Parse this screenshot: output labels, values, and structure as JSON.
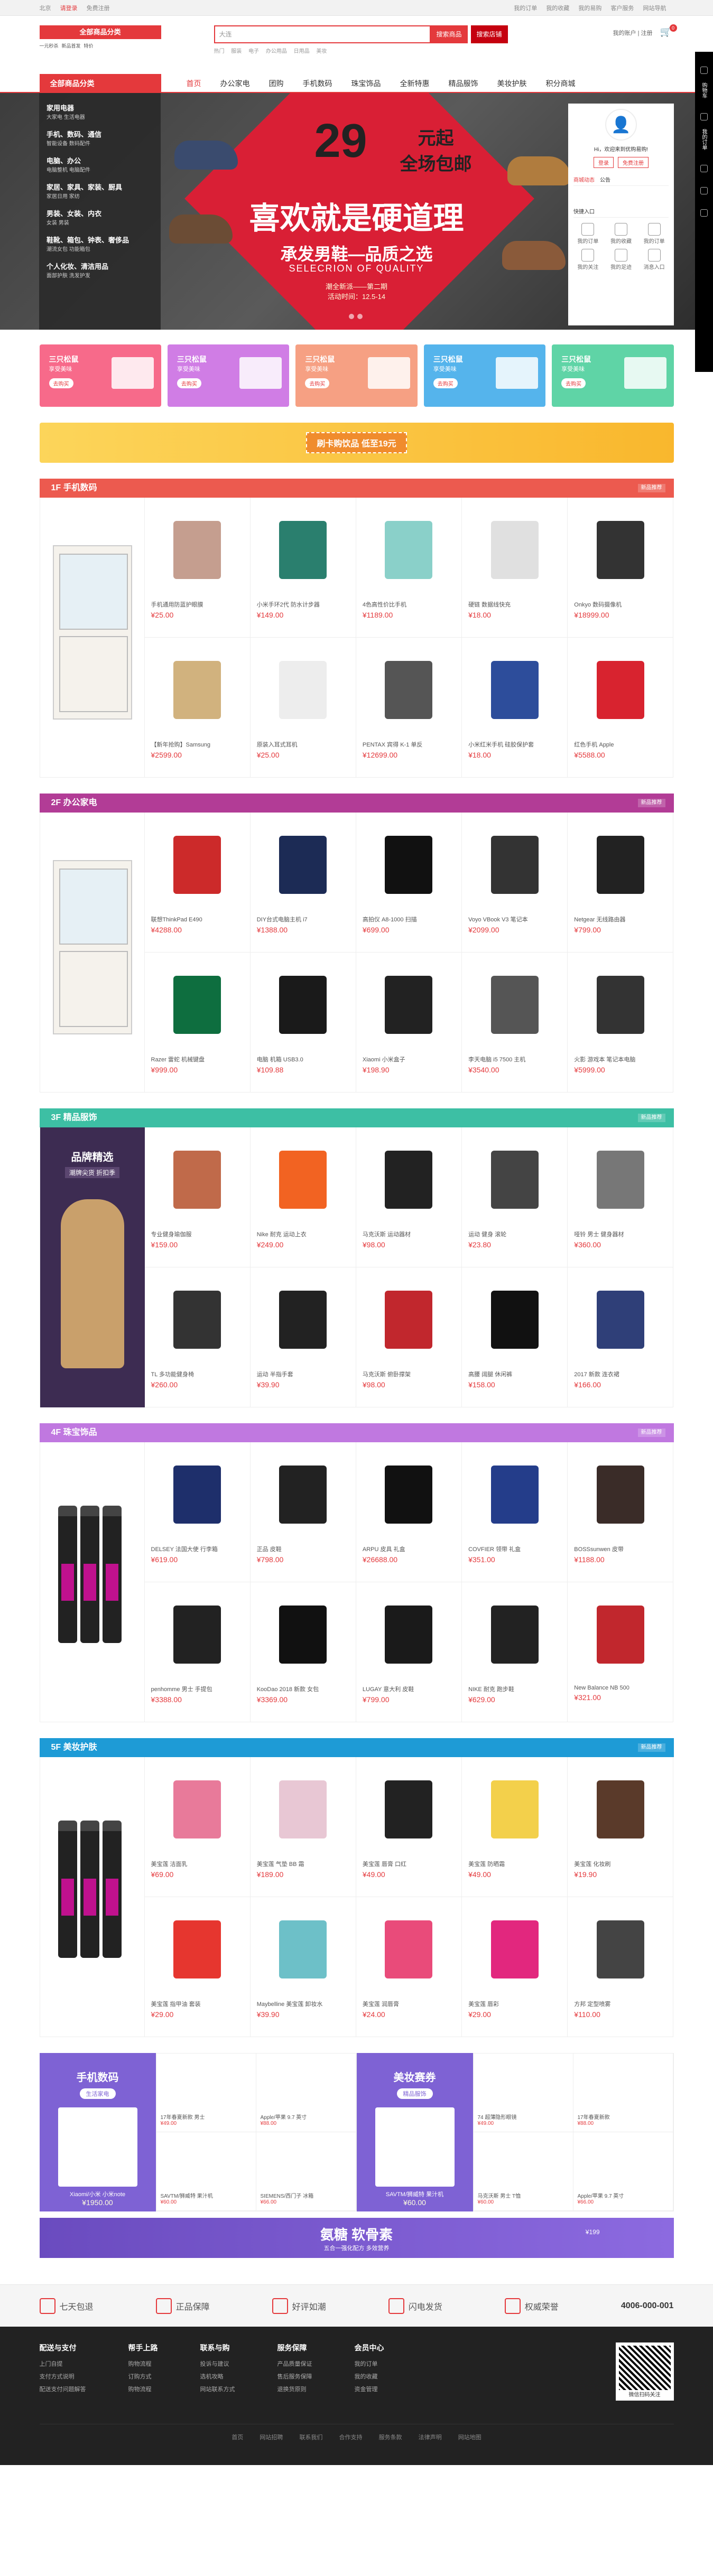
{
  "top": {
    "location": "北京",
    "login": "请登录",
    "register": "免费注册",
    "links": [
      "我的订单",
      "我的收藏",
      "我的易购",
      "客户服务",
      "网站导航"
    ]
  },
  "logo": {
    "title": "全部商品分类",
    "sub": [
      "一元秒杀",
      "新品首发",
      "特价"
    ]
  },
  "search": {
    "placeholder": "大连",
    "btn1": "搜索商品",
    "btn2": "搜索店铺",
    "hot": [
      "热门",
      "服装",
      "电子",
      "办公用品",
      "日用品",
      "美妆"
    ]
  },
  "hright": "我的账户 | 注册",
  "cart": {
    "count": "0"
  },
  "nav": {
    "allcat": "全部商品分类",
    "items": [
      "首页",
      "办公家电",
      "团购",
      "手机数码",
      "珠宝饰品",
      "全新特惠",
      "精品服饰",
      "美妆护肤",
      "积分商城"
    ]
  },
  "catmenu": [
    {
      "t": "家用电器",
      "s": "大家电  生活电器"
    },
    {
      "t": "手机、数码、通信",
      "s": "智能设备  数码配件"
    },
    {
      "t": "电脑、办公",
      "s": "电脑整机  电脑配件"
    },
    {
      "t": "家居、家具、家装、厨具",
      "s": "家居日用  家纺"
    },
    {
      "t": "男装、女装、内衣",
      "s": "女装  男装"
    },
    {
      "t": "鞋靴、箱包、钟表、奢侈品",
      "s": "潮流女包  功能箱包"
    },
    {
      "t": "个人化妆、清洁用品",
      "s": "面部护肤  洗发护发"
    }
  ],
  "banner": {
    "a": "29",
    "b": "元起",
    "c": "全场包邮",
    "d": "喜欢就是硬道理",
    "e": "承发男鞋—品质之选",
    "f": "SELECRION OF QUALITY",
    "g": "潮全新派——第二期",
    "h": "活动时间：12.5-14"
  },
  "user": {
    "hi": "Hi，欢迎来到优购易购!",
    "login": "登录",
    "reg": "免费注册",
    "tabs": [
      "商城动态",
      "公告"
    ],
    "note": "快捷入口",
    "items": [
      "我的订单",
      "我的收藏",
      "我的订单",
      "我的关注",
      "我的足迹",
      "消息入口"
    ]
  },
  "side": [
    "购物车",
    "我的订单"
  ],
  "promos": [
    {
      "t": "三只松鼠",
      "s": "享受美味",
      "b": "去购买",
      "c": "#f76a8a"
    },
    {
      "t": "三只松鼠",
      "s": "享受美味",
      "b": "去购买",
      "c": "#d07de5"
    },
    {
      "t": "三只松鼠",
      "s": "享受美味",
      "b": "去购买",
      "c": "#f6a083"
    },
    {
      "t": "三只松鼠",
      "s": "享受美味",
      "b": "去购买",
      "c": "#55b4ec"
    },
    {
      "t": "三只松鼠",
      "s": "享受美味",
      "b": "去购买",
      "c": "#5fd4a6"
    }
  ],
  "adbar": "刷卡购饮品 低至19元",
  "floors": [
    {
      "title": "1F 手机数码",
      "more": "新品推荐",
      "color": "#ec5a4f",
      "left": "cab",
      "items": [
        {
          "n": "手机通用防蓝护眼膜",
          "p": "¥25.00",
          "c": "#c59e8f"
        },
        {
          "n": "小米手环2代 防水计步器",
          "p": "¥149.00",
          "c": "#2a7f6e"
        },
        {
          "n": "4色高性价比手机",
          "p": "¥1189.00",
          "c": "#8ad0c9"
        },
        {
          "n": "硬链 数据线快充",
          "p": "¥18.00",
          "c": "#e0e0e0"
        },
        {
          "n": "Onkyo 数码摄像机",
          "p": "¥18999.00",
          "c": "#333"
        },
        {
          "n": "【新年抢购】Samsung",
          "p": "¥2599.00",
          "c": "#d1b27e"
        },
        {
          "n": "原装入耳式耳机",
          "p": "¥25.00",
          "c": "#ededed"
        },
        {
          "n": "PENTAX 宾得 K-1 单反",
          "p": "¥12699.00",
          "c": "#555"
        },
        {
          "n": "小米红米手机 硅胶保护套",
          "p": "¥18.00",
          "c": "#2d4d9b"
        },
        {
          "n": "红色手机 Apple",
          "p": "¥5588.00",
          "c": "#d8232f"
        }
      ]
    },
    {
      "title": "2F 办公家电",
      "more": "新品推荐",
      "color": "#b23c96",
      "left": "cab",
      "items": [
        {
          "n": "联想ThinkPad E490",
          "p": "¥4288.00",
          "c": "#cc2a2a"
        },
        {
          "n": "DIY台式电脑主机 i7",
          "p": "¥1388.00",
          "c": "#1c2b55"
        },
        {
          "n": "高拍仪 A8-1000 扫描",
          "p": "¥699.00",
          "c": "#111"
        },
        {
          "n": "Voyo VBook V3 笔记本",
          "p": "¥2099.00",
          "c": "#333"
        },
        {
          "n": "Netgear 无线路由器",
          "p": "¥799.00",
          "c": "#222"
        },
        {
          "n": "Razer 雷蛇 机械键盘",
          "p": "¥999.00",
          "c": "#0e6e3f"
        },
        {
          "n": "电脑 机箱 USB3.0",
          "p": "¥109.88",
          "c": "#1a1a1a"
        },
        {
          "n": "Xiaomi 小米盒子",
          "p": "¥198.90",
          "c": "#222"
        },
        {
          "n": "李天电脑 i5 7500 主机",
          "p": "¥3540.00",
          "c": "#555"
        },
        {
          "n": "火影 游戏本 笔记本电脑",
          "p": "¥5999.00",
          "c": "#333"
        }
      ]
    },
    {
      "title": "3F 精品服饰",
      "more": "新品推荐",
      "color": "#3dbfa4",
      "left": "pin",
      "items": [
        {
          "n": "专业健身瑜伽服",
          "p": "¥159.00",
          "c": "#c06a4a"
        },
        {
          "n": "Nike 耐克 运动上衣",
          "p": "¥249.00",
          "c": "#f26322"
        },
        {
          "n": "马克沃斯 运动器材",
          "p": "¥98.00",
          "c": "#222"
        },
        {
          "n": "运动 健身 滚轮",
          "p": "¥23.80",
          "c": "#444"
        },
        {
          "n": "哑铃 男士 健身器材",
          "p": "¥360.00",
          "c": "#777"
        },
        {
          "n": "TL 多功能健身椅",
          "p": "¥260.00",
          "c": "#333"
        },
        {
          "n": "运动 半指手套",
          "p": "¥39.90",
          "c": "#222"
        },
        {
          "n": "马克沃斯 俯卧撑架",
          "p": "¥98.00",
          "c": "#c1272d"
        },
        {
          "n": "高腰 阔腿 休闲裤",
          "p": "¥158.00",
          "c": "#111"
        },
        {
          "n": "2017 新款 连衣裙",
          "p": "¥166.00",
          "c": "#2f3f78"
        }
      ]
    },
    {
      "title": "4F 珠宝饰品",
      "more": "新品推荐",
      "color": "#c078e0",
      "left": "bottles",
      "items": [
        {
          "n": "DELSEY 法国大使 行李箱",
          "p": "¥619.00",
          "c": "#1e2f6b"
        },
        {
          "n": "正品 皮鞋",
          "p": "¥798.00",
          "c": "#222"
        },
        {
          "n": "ARPU 皮具 礼盒",
          "p": "¥26688.00",
          "c": "#111"
        },
        {
          "n": "COVFIER 领带 礼盒",
          "p": "¥351.00",
          "c": "#243d8a"
        },
        {
          "n": "BOSSsunwen 皮带",
          "p": "¥1188.00",
          "c": "#3a2c28"
        },
        {
          "n": "penhomme 男士 手提包",
          "p": "¥3388.00",
          "c": "#222"
        },
        {
          "n": "KooDao 2018 新款 女包",
          "p": "¥3369.00",
          "c": "#111"
        },
        {
          "n": "LUGAY 意大利 皮鞋",
          "p": "¥799.00",
          "c": "#1a1a1a"
        },
        {
          "n": "NIKE 耐克 跑步鞋",
          "p": "¥629.00",
          "c": "#222"
        },
        {
          "n": "New Balance NB 500",
          "p": "¥321.00",
          "c": "#c1272d"
        }
      ]
    },
    {
      "title": "5F 美妆护肤",
      "more": "新品推荐",
      "color": "#1e9bd6",
      "left": "bottles",
      "items": [
        {
          "n": "美宝莲 洁面乳",
          "p": "¥69.00",
          "c": "#e87a9a"
        },
        {
          "n": "美宝莲 气垫 BB 霜",
          "p": "¥189.00",
          "c": "#e8c7d4"
        },
        {
          "n": "美宝莲 唇膏 口红",
          "p": "¥49.00",
          "c": "#222"
        },
        {
          "n": "美宝莲 防晒霜",
          "p": "¥49.00",
          "c": "#f3d04b"
        },
        {
          "n": "美宝莲 化妆刷",
          "p": "¥19.90",
          "c": "#5a3a2a"
        },
        {
          "n": "美宝莲 指甲油 套装",
          "p": "¥29.00",
          "c": "#e6362f"
        },
        {
          "n": "Maybelline 美宝莲 卸妆水",
          "p": "¥39.90",
          "c": "#6dc0c8"
        },
        {
          "n": "美宝莲 润唇膏",
          "p": "¥24.00",
          "c": "#e94b7a"
        },
        {
          "n": "美宝莲 唇彩",
          "p": "¥29.00",
          "c": "#e2277e"
        },
        {
          "n": "方邦 定型喷雾",
          "p": "¥110.00",
          "c": "#444"
        }
      ]
    }
  ],
  "pstrips": [
    {
      "title": "手机数码",
      "sub": "生活家电",
      "pn": "Xiaomi/小米 小米note",
      "pp": "¥1950.00",
      "cells": [
        {
          "n": "17年春夏新款 男士",
          "p": "¥49.00"
        },
        {
          "n": "Apple/苹果 9.7 英寸",
          "p": "¥88.00"
        },
        {
          "n": "SAVTM/狮威特 果汁机",
          "p": "¥60.00"
        },
        {
          "n": "SIEMENS/西门子 冰箱",
          "p": "¥66.00"
        }
      ]
    },
    {
      "title": "美妆赛券",
      "sub": "精品服饰",
      "pn": "SAVTM/狮威特 果汁机",
      "pp": "¥60.00",
      "cells": [
        {
          "n": "74 超薄隐形眼镜",
          "p": "¥49.00"
        },
        {
          "n": "17年春夏新款",
          "p": "¥88.00"
        },
        {
          "n": "马克沃斯 男士 T恤",
          "p": "¥60.00"
        },
        {
          "n": "Apple/苹果 9.7 英寸",
          "p": "¥66.00"
        }
      ]
    }
  ],
  "bonebar": {
    "t": "氨糖 软骨素",
    "s": "五合一强化配方 多效营养",
    "p": "¥199"
  },
  "svc": {
    "items": [
      "七天包退",
      "正品保障",
      "好评如潮",
      "闪电发货",
      "权威荣誉"
    ],
    "tel": "4006-000-001"
  },
  "footer": {
    "cols": [
      {
        "t": "配送与支付",
        "l": [
          "上门自提",
          "支付方式说明",
          "配送支付问题解答"
        ]
      },
      {
        "t": "帮手上路",
        "l": [
          "购物流程",
          "订购方式",
          "购物流程"
        ]
      },
      {
        "t": "联系与购",
        "l": [
          "投诉与建议",
          "选机攻略",
          "网站联系方式"
        ]
      },
      {
        "t": "服务保障",
        "l": [
          "产品质量保证",
          "售后服务保障",
          "退换货原则"
        ]
      },
      {
        "t": "会员中心",
        "l": [
          "我的订单",
          "我的收藏",
          "资金管理"
        ]
      }
    ],
    "qrlabel": "微信扫码关注",
    "links": [
      "首页",
      "网站招聘",
      "联系我们",
      "合作支持",
      "服务条款",
      "法律声明",
      "网站地图"
    ]
  }
}
